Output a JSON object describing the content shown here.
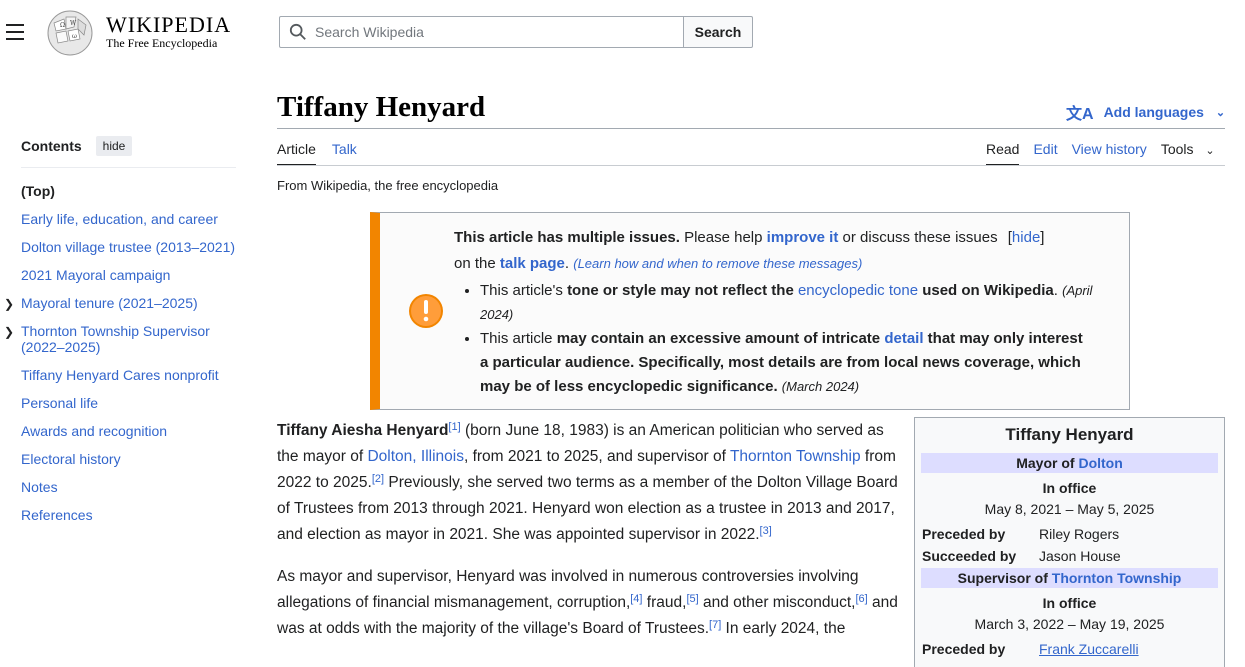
{
  "header": {
    "wordmark": "WIKIPEDIA",
    "tagline": "The Free Encyclopedia",
    "search_placeholder": "Search Wikipedia",
    "search_button": "Search"
  },
  "toc": {
    "title": "Contents",
    "hide": "hide",
    "items": [
      {
        "label": "(Top)",
        "expandable": false
      },
      {
        "label": "Early life, education, and career",
        "expandable": false
      },
      {
        "label": "Dolton village trustee (2013–2021)",
        "expandable": false
      },
      {
        "label": "2021 Mayoral campaign",
        "expandable": false
      },
      {
        "label": "Mayoral tenure (2021–2025)",
        "expandable": true
      },
      {
        "label": "Thornton Township Supervisor (2022–2025)",
        "expandable": true
      },
      {
        "label": "Tiffany Henyard Cares nonprofit",
        "expandable": false
      },
      {
        "label": "Personal life",
        "expandable": false
      },
      {
        "label": "Awards and recognition",
        "expandable": false
      },
      {
        "label": "Electoral history",
        "expandable": false
      },
      {
        "label": "Notes",
        "expandable": false
      },
      {
        "label": "References",
        "expandable": false
      }
    ]
  },
  "article": {
    "title": "Tiffany Henyard",
    "add_languages": "Add languages",
    "tabs_left": [
      "Article",
      "Talk"
    ],
    "tabs_right": [
      "Read",
      "Edit",
      "View history",
      "Tools"
    ],
    "from": "From Wikipedia, the free encyclopedia"
  },
  "issues": {
    "lead_bold": "This article has multiple issues.",
    "lead_1": " Please help ",
    "improve": "improve it",
    "lead_2": " or discuss these issues ",
    "hide": "[hide]",
    "on_the": "on the ",
    "talk_page": "talk page",
    "learn": "(Learn how and when to remove these messages)",
    "issue1_a": "This article's ",
    "issue1_b": "tone or style may not reflect the ",
    "issue1_link": "encyclopedic tone",
    "issue1_c": " used on Wikipedia",
    "issue1_date": "(April 2024)",
    "issue2_a": "This article ",
    "issue2_b": "may contain an excessive amount of intricate ",
    "issue2_link": "detail",
    "issue2_c": " that may only interest a particular audience",
    "issue2_d": " Specifically, most details are from local news coverage, which may be of less encyclopedic significance.",
    "issue2_date": "(March 2024)"
  },
  "body": {
    "name_bold": "Tiffany Aiesha Henyard",
    "p1_a": " (born June 18, 1983) is an American politician who served as the mayor of ",
    "dolton": "Dolton, Illinois",
    "p1_b": ", from 2021 to 2025, and supervisor of ",
    "thornton": "Thornton Township",
    "p1_c": " from 2022 to 2025.",
    "p1_d": " Previously, she served two terms as a member of the Dolton Village Board of Trustees from 2013 through 2021. Henyard won election as a trustee in 2013 and 2017, and election as mayor in 2021. She was appointed supervisor in 2022.",
    "p2_a": "As mayor and supervisor, Henyard was involved in numerous controversies involving allegations of financial mismanagement, corruption,",
    "p2_b": " fraud,",
    "p2_c": " and other misconduct,",
    "p2_d": " and was at odds with the majority of the village's Board of Trustees.",
    "p2_e": " In early 2024, the",
    "refs": [
      "[1]",
      "[2]",
      "[3]",
      "[4]",
      "[5]",
      "[6]",
      "[7]"
    ]
  },
  "infobox": {
    "title": "Tiffany Henyard",
    "mayor_of": "Mayor of ",
    "dolton": "Dolton",
    "in_office": "In office",
    "term1": "May 8, 2021 – May 5, 2025",
    "preceded_by": "Preceded by",
    "preceded1": "Riley Rogers",
    "succeeded_by": "Succeeded by",
    "succeeded1": "Jason House",
    "supervisor_of": "Supervisor of ",
    "thornton": "Thornton Township",
    "term2": "March 3, 2022 – May 19, 2025",
    "preceded2": "Frank Zuccarelli"
  },
  "colors": {
    "link": "#3366cc",
    "ambox_border": "#f28500",
    "infobox_band": "#ddddff"
  }
}
